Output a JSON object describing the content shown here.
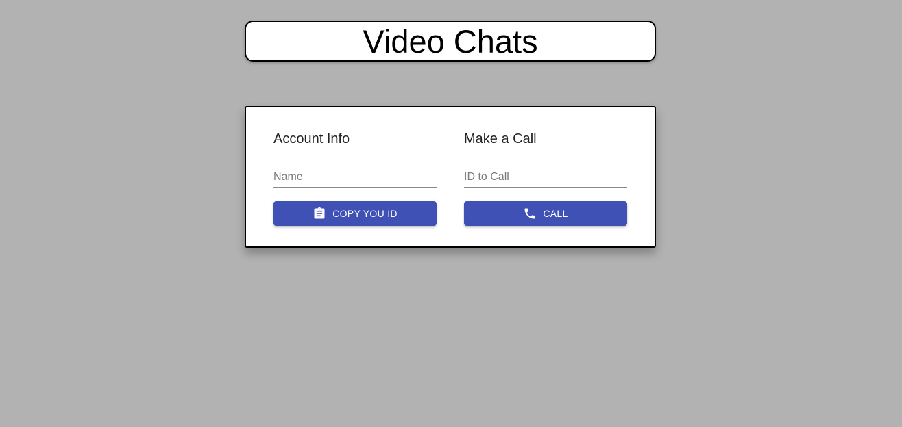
{
  "header": {
    "title": "Video Chats"
  },
  "account_info": {
    "heading": "Account Info",
    "name_placeholder": "Name",
    "name_value": "",
    "copy_button_label": "COPY YOU ID",
    "copy_button_icon": "clipboard-icon"
  },
  "make_call": {
    "heading": "Make a Call",
    "id_placeholder": "ID to Call",
    "id_value": "",
    "call_button_label": "CALL",
    "call_button_icon": "phone-icon"
  },
  "colors": {
    "background": "#b2b2b2",
    "primary": "#3f51b5",
    "card": "#ffffff"
  }
}
